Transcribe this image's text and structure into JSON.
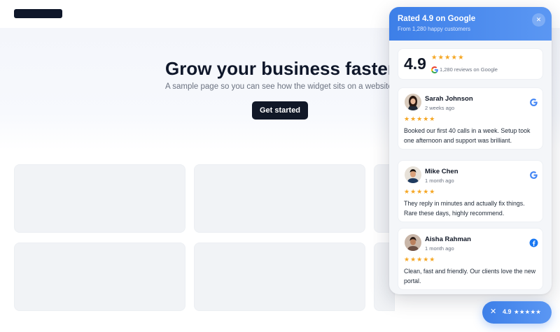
{
  "hero": {
    "title": "Grow your business faster",
    "subtitle": "A sample page so you can see how the widget sits on a website.",
    "cta_label": "Get started"
  },
  "widget": {
    "title": "Rated 4.9 on Google",
    "subtitle": "From 1,280 happy customers",
    "close_label": "✕",
    "summary": {
      "score": "4.9",
      "stars": "★★★★★",
      "count_text": "1,280 reviews on Google"
    },
    "reviews": [
      {
        "name": "Sarah Johnson",
        "time": "2 weeks ago",
        "stars": "★★★★★",
        "text": "Booked our first 40 calls in a week. Setup took one afternoon and support was brilliant.",
        "source_icon": "google-icon"
      },
      {
        "name": "Mike Chen",
        "time": "1 month ago",
        "stars": "★★★★★",
        "text": "They reply in minutes and actually fix things. Rare these days, highly recommend.",
        "source_icon": "google-icon"
      },
      {
        "name": "Aisha Rahman",
        "time": "1 month ago",
        "stars": "★★★★★",
        "text": "Clean, fast and friendly. Our clients love the new portal.",
        "source_icon": "facebook-icon"
      }
    ]
  },
  "launcher": {
    "close_label": "✕",
    "score": "4.9",
    "stars": "★★★★★"
  },
  "colors": {
    "accent": "#3d7fe8",
    "star": "#f5a623",
    "cta_bg": "#111827"
  }
}
